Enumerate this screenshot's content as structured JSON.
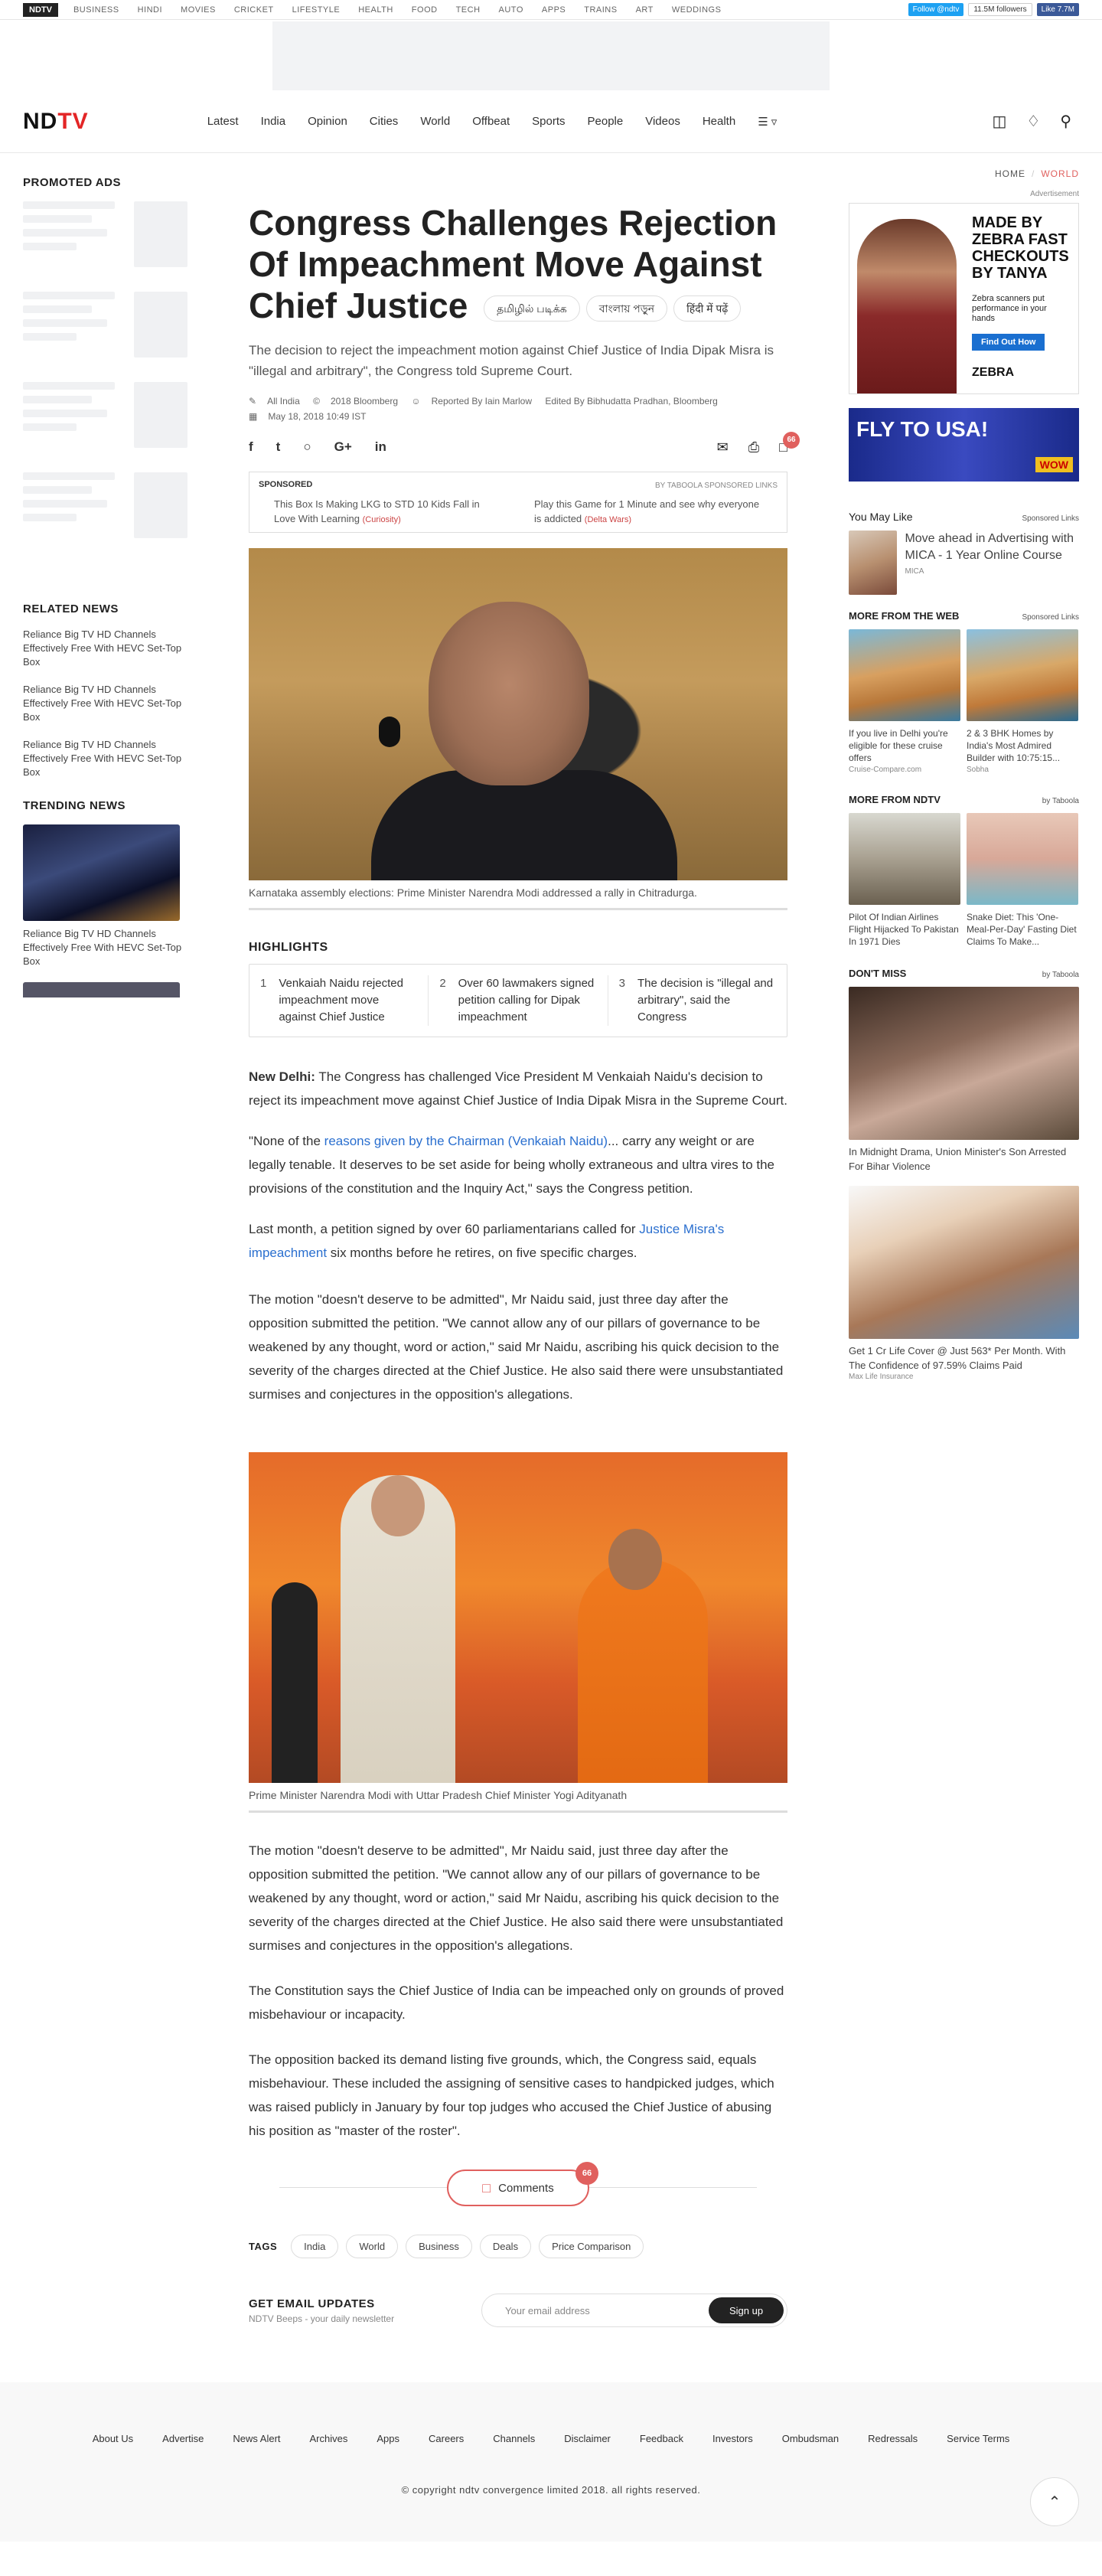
{
  "topbar": {
    "brand": "NDTV",
    "links": [
      "BUSINESS",
      "HINDI",
      "MOVIES",
      "CRICKET",
      "LIFESTYLE",
      "HEALTH",
      "FOOD",
      "TECH",
      "AUTO",
      "APPS",
      "TRAINS",
      "ART",
      "WEDDINGS"
    ],
    "twitter_follow": "Follow @ndtv",
    "twitter_count": "11.5M followers",
    "facebook_like": "Like 7.7M"
  },
  "nav": {
    "logo_prefix": "ND",
    "logo_suffix": "TV",
    "links": [
      "Latest",
      "India",
      "Opinion",
      "Cities",
      "World",
      "Offbeat",
      "Sports",
      "People",
      "Videos",
      "Health"
    ],
    "more": "☰ ▿"
  },
  "left": {
    "promoted_title": "PROMOTED ADS",
    "related_title": "RELATED  NEWS",
    "related": [
      "Reliance Big TV HD Channels Effectively Free With HEVC Set-Top Box",
      "Reliance Big TV HD Channels Effectively Free With HEVC Set-Top Box",
      "Reliance Big TV HD Channels Effectively Free With HEVC Set-Top Box"
    ],
    "trending_title": "TRENDING  NEWS",
    "trending": [
      "Reliance Big TV HD Channels Effectively Free With HEVC Set-Top Box"
    ]
  },
  "article": {
    "breadcrumb_home": "HOME",
    "breadcrumb_section": "WORLD",
    "headline": "Congress Challenges Rejection Of Impeachment Move Against Chief Justice",
    "lang_tamil": "தமிழில் படிக்க",
    "lang_bangla": "বাংলায় পড়ুন",
    "lang_hindi": "हिंदी में पढ़ें",
    "lead": "The decision to reject the impeachment motion against Chief Justice of India Dipak Misra is \"illegal and arbitrary\", the Congress told Supreme Court.",
    "meta_category": "All India",
    "meta_copyright": "2018 Bloomberg",
    "meta_reported": "Reported By Iain Marlow",
    "meta_edited": "Edited By Bibhudatta Pradhan, Bloomberg",
    "meta_date": "May 18, 2018 10:49 IST",
    "comment_count": "66",
    "sponsored_label": "SPONSORED",
    "sponsored_tag": "BY TABOOLA  SPONSORED LINKS",
    "sponsored_1": "This Box Is Making LKG to STD 10 Kids Fall in Love With Learning",
    "sponsored_1_src": "(Curiosity)",
    "sponsored_2": "Play this Game for 1 Minute and see why everyone is addicted",
    "sponsored_2_src": "(Delta Wars)",
    "caption1": "Karnataka assembly elections: Prime Minister Narendra Modi addressed a rally in Chitradurga.",
    "highlights_title": "HIGHLIGHTS",
    "highlights": [
      "Venkaiah Naidu rejected impeachment move against Chief Justice",
      "Over 60 lawmakers signed petition calling for Dipak impeachment",
      "The decision is \"illegal and arbitrary\", said the Congress"
    ],
    "dateline": "New Delhi:",
    "p1": "The Congress has challenged Vice President M Venkaiah Naidu's decision to reject its impeachment move against Chief Justice of India Dipak Misra in the Supreme Court.",
    "p2_start": "\"None of the ",
    "p2_link": "reasons given by the Chairman (Venkaiah Naidu)",
    "p2_end": "... carry any weight or are legally tenable. It deserves to be set aside for being wholly extraneous and ultra vires to the provisions of the constitution and the Inquiry Act,\" says the Congress petition.",
    "p3_start": "Last month, a petition signed by over 60 parliamentarians called for ",
    "p3_link": "Justice Misra's impeachment",
    "p3_end": " six months before he retires, on five specific charges.",
    "p4": "The motion \"doesn't deserve to be admitted\", Mr Naidu said, just three day after the opposition submitted the petition. \"We cannot allow any of our pillars of governance to be weakened by any thought, word or action,\" said Mr Naidu, ascribing his quick decision to the severity of the charges directed at the Chief Justice. He also said there were unsubstantiated surmises and conjectures in the opposition's allegations.",
    "caption2": "Prime Minister Narendra Modi with Uttar Pradesh Chief Minister Yogi Adityanath",
    "p5": "The motion \"doesn't deserve to be admitted\", Mr Naidu said, just three day after the opposition submitted the petition. \"We cannot allow any of our pillars of governance to be weakened by any thought, word or action,\" said Mr Naidu, ascribing his quick decision to the severity of the charges directed at the Chief Justice. He also said there were unsubstantiated surmises and conjectures in the opposition's allegations.",
    "p6": "The Constitution says the Chief Justice of India can be impeached only on grounds of proved misbehaviour or incapacity.",
    "p7": "The opposition backed its demand listing five grounds, which, the Congress said, equals misbehaviour. These included the assigning of sensitive cases to handpicked judges, which was raised publicly in January by four top judges who accused the Chief Justice of abusing his position as \"master of the roster\".",
    "comments_label": "Comments",
    "tags_label": "TAGS",
    "tags": [
      "India",
      "World",
      "Business",
      "Deals",
      "Price Comparison"
    ],
    "email_title": "GET EMAIL UPDATES",
    "email_sub": "NDTV Beeps - your daily newsletter",
    "email_placeholder": "Your email address",
    "email_button": "Sign up"
  },
  "right": {
    "ad_label": "Advertisement",
    "ad1_text": "MADE BY ZEBRA FAST CHECKOUTS BY TANYA",
    "ad1_sub": "Zebra scanners put performance in your hands",
    "ad1_button": "Find Out How",
    "ad1_brand": "ZEBRA",
    "ad2_text": "FLY TO USA!",
    "ad2_badge": "WOW",
    "you_may_like": "You May Like",
    "sponsored_links": "Sponsored Links",
    "yml_text": "Move ahead in Advertising with MICA - 1 Year Online Course",
    "yml_src": "MICA",
    "more_web": "MORE FROM THE WEB",
    "web_items": [
      {
        "text": "If you live in Delhi you're eligible for these cruise offers",
        "src": "Cruise-Compare.com"
      },
      {
        "text": "2 & 3 BHK Homes by India's Most Admired Builder with 10:75:15...",
        "src": "Sobha"
      }
    ],
    "more_ndtv": "MORE FROM NDTV",
    "by_taboola": "by Taboola",
    "ndtv_items": [
      {
        "text": "Pilot Of Indian Airlines Flight Hijacked To Pakistan In 1971 Dies"
      },
      {
        "text": "Snake Diet: This 'One-Meal-Per-Day' Fasting Diet Claims To Make..."
      }
    ],
    "dont_miss": "DON'T MISS",
    "dm1": "In Midnight Drama, Union Minister's Son Arrested For Bihar Violence",
    "dm2": "Get 1 Cr Life Cover @ Just 563* Per Month. With The Confidence of 97.59% Claims Paid",
    "dm2_src": "Max Life Insurance"
  },
  "footer": {
    "links": [
      "About Us",
      "Advertise",
      "News Alert",
      "Archives",
      "Apps",
      "Careers",
      "Channels",
      "Disclaimer",
      "Feedback",
      "Investors",
      "Ombudsman",
      "Redressals",
      "Service Terms"
    ],
    "copyright": "© copyright ndtv convergence limited 2018. all rights reserved."
  }
}
